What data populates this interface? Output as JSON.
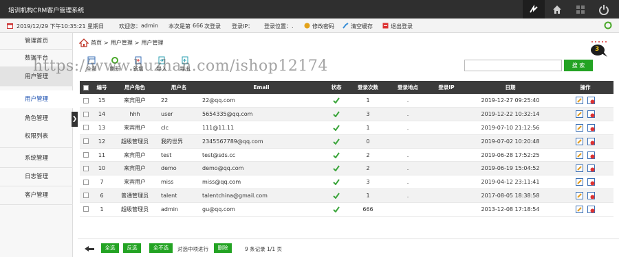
{
  "header": {
    "title": "培训机构CRM客户管理系统",
    "buttons": [
      "switch-icon",
      "home-icon",
      "grid-icon",
      "power-icon"
    ]
  },
  "infobar": {
    "datetime": "2019/12/29 下午10:35:21 星期日",
    "welcome_label": "欢迎您：",
    "username": "admin",
    "login_prefix": "本次是第",
    "login_count": "666",
    "login_suffix": "次登录",
    "ip_label": "登录IP：",
    "location_label": "登录位置：.",
    "change_password": "修改密码",
    "clear_cache": "清空缓存",
    "logout": "退出登录"
  },
  "sidebar": {
    "items": [
      {
        "label": "管理首页"
      },
      {
        "label": "数据平台"
      },
      {
        "label": "用户管理"
      },
      {
        "label": "用户管理"
      },
      {
        "label": "角色管理"
      },
      {
        "label": "权限列表"
      },
      {
        "label": "系统管理"
      },
      {
        "label": "日志管理"
      },
      {
        "label": "客户管理"
      }
    ]
  },
  "breadcrumb": {
    "home": "首页",
    "sep": ">",
    "level1": "用户管理",
    "level2": "用户管理"
  },
  "message_count": "3",
  "toolbar": {
    "select_all": "全部",
    "refresh": "刷新",
    "add": "新增",
    "import": "导入",
    "export": "导出"
  },
  "search": {
    "value": "",
    "button": "搜 索"
  },
  "table": {
    "columns": [
      "编号",
      "用户角色",
      "用户名",
      "Email",
      "状态",
      "登录次数",
      "登录地点",
      "登录IP",
      "日期",
      "操作"
    ],
    "rows": [
      {
        "id": "15",
        "role": "来宾用户",
        "username": "22",
        "email": "22@qq.com",
        "count": "1",
        "place": ".",
        "ip": "",
        "date": "2019-12-27 09:25:40"
      },
      {
        "id": "14",
        "role": "hhh",
        "username": "user",
        "email": "5654335@qq.com",
        "count": "3",
        "place": ".",
        "ip": "",
        "date": "2019-12-22 10:32:14"
      },
      {
        "id": "13",
        "role": "来宾用户",
        "username": "clc",
        "email": "111@11.11",
        "count": "1",
        "place": ".",
        "ip": "",
        "date": "2019-07-10 21:12:56"
      },
      {
        "id": "12",
        "role": "超级管理员",
        "username": "我的世界",
        "email": "2345567789@qq.com",
        "count": "0",
        "place": "",
        "ip": "",
        "date": "2019-07-02 10:20:48"
      },
      {
        "id": "11",
        "role": "来宾用户",
        "username": "test",
        "email": "test@sds.cc",
        "count": "2",
        "place": ".",
        "ip": "",
        "date": "2019-06-28 17:52:25"
      },
      {
        "id": "10",
        "role": "来宾用户",
        "username": "demo",
        "email": "demo@qq.com",
        "count": "2",
        "place": ".",
        "ip": "",
        "date": "2019-06-19 15:04:52"
      },
      {
        "id": "7",
        "role": "来宾用户",
        "username": "miss",
        "email": "miss@qq.com",
        "count": "3",
        "place": ".",
        "ip": "",
        "date": "2019-04-12 23:11:41"
      },
      {
        "id": "6",
        "role": "普通管理员",
        "username": "talent",
        "email": "talentchina@gmail.com",
        "count": "1",
        "place": ".",
        "ip": "",
        "date": "2017-08-05 18:38:58"
      },
      {
        "id": "1",
        "role": "超级管理员",
        "username": "admin",
        "email": "gu@qq.com",
        "count": "666",
        "place": "",
        "ip": "",
        "date": "2013-12-08 17:18:54"
      }
    ]
  },
  "footer": {
    "select_all": "全选",
    "invert": "反选",
    "select_none": "全不选",
    "selected_action": "对选中项进行",
    "delete": "删除",
    "records": "9 条记录 1/1 页"
  },
  "watermark": "https://www.huzhan.com/ishop12174",
  "colors": {
    "header_bg": "#2f2f2f",
    "accent_green": "#23a323",
    "status_green": "#3aa53a",
    "highlight_red": "#dd0000"
  }
}
